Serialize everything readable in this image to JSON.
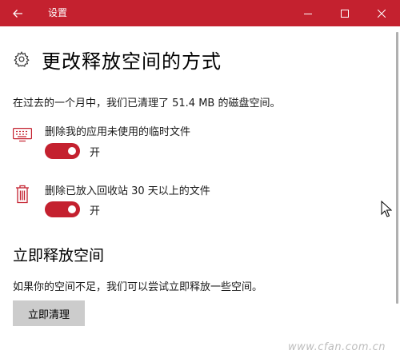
{
  "window": {
    "title": "设置"
  },
  "page": {
    "title": "更改释放空间的方式",
    "icon": "gear-icon"
  },
  "summary": "在过去的一个月中，我们已清理了 51.4 MB 的磁盘空间。",
  "settings": [
    {
      "icon": "keyboard-icon",
      "label": "删除我的应用未使用的临时文件",
      "state": "开",
      "on": true
    },
    {
      "icon": "trash-icon",
      "label": "删除已放入回收站 30 天以上的文件",
      "state": "开",
      "on": true
    }
  ],
  "free_now": {
    "title": "立即释放空间",
    "description": "如果你的空间不足，我们可以尝试立即释放一些空间。",
    "button": "立即清理"
  },
  "watermark": "www.cfan.com.cn",
  "colors": {
    "accent": "#c4212f",
    "button_bg": "#cccccc"
  }
}
